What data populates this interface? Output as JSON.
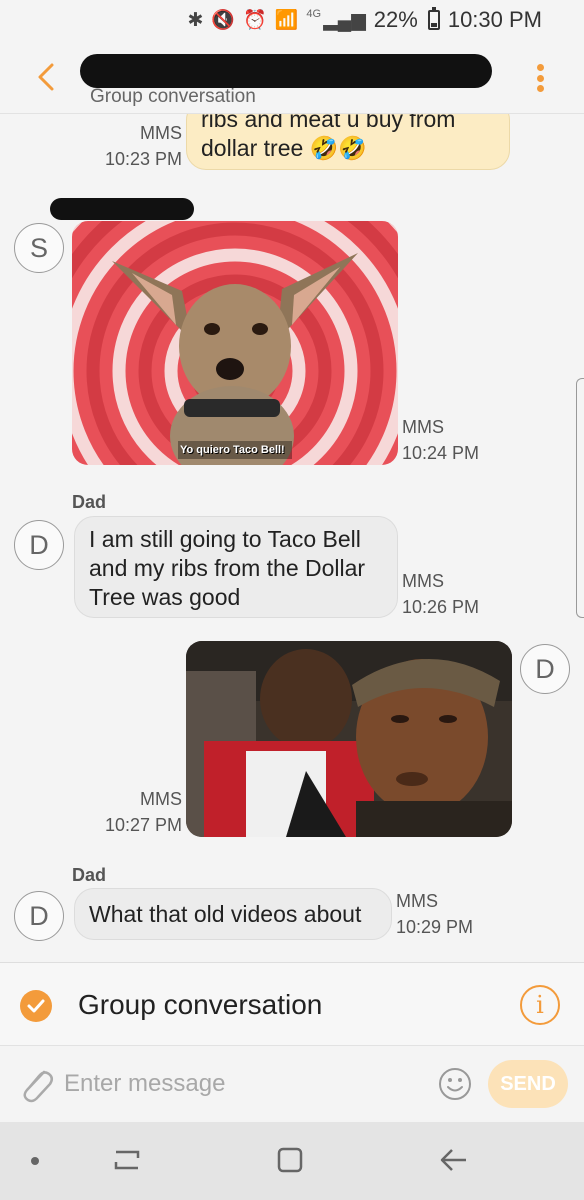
{
  "status_bar": {
    "network": "4G",
    "battery": "22%",
    "time": "10:30 PM"
  },
  "header": {
    "subtitle": "Group conversation"
  },
  "messages": {
    "m1": {
      "text_line1": "ribs and meat u buy from",
      "text_line2": "dollar tree",
      "emoji": "🤣🤣",
      "type": "MMS",
      "time": "10:23 PM"
    },
    "m2": {
      "avatar": "S",
      "caption": "Yo quiero Taco Bell!",
      "type": "MMS",
      "time": "10:24 PM"
    },
    "m3": {
      "sender": "Dad",
      "avatar": "D",
      "line1": "I am still going to Taco Bell",
      "line2": "and my ribs from the Dollar",
      "line3": "Tree was good",
      "type": "MMS",
      "time": "10:26 PM"
    },
    "m4": {
      "avatar": "D",
      "type": "MMS",
      "time": "10:27 PM"
    },
    "m5": {
      "sender": "Dad",
      "avatar": "D",
      "text": "What that old videos about",
      "type": "MMS",
      "time": "10:29 PM"
    }
  },
  "group_bar": {
    "label": "Group conversation"
  },
  "compose": {
    "placeholder": "Enter message",
    "send_label": "SEND"
  },
  "colors": {
    "accent": "#f39b3b",
    "outgoing_bubble": "#fcecc4",
    "incoming_bubble": "#ececec"
  }
}
